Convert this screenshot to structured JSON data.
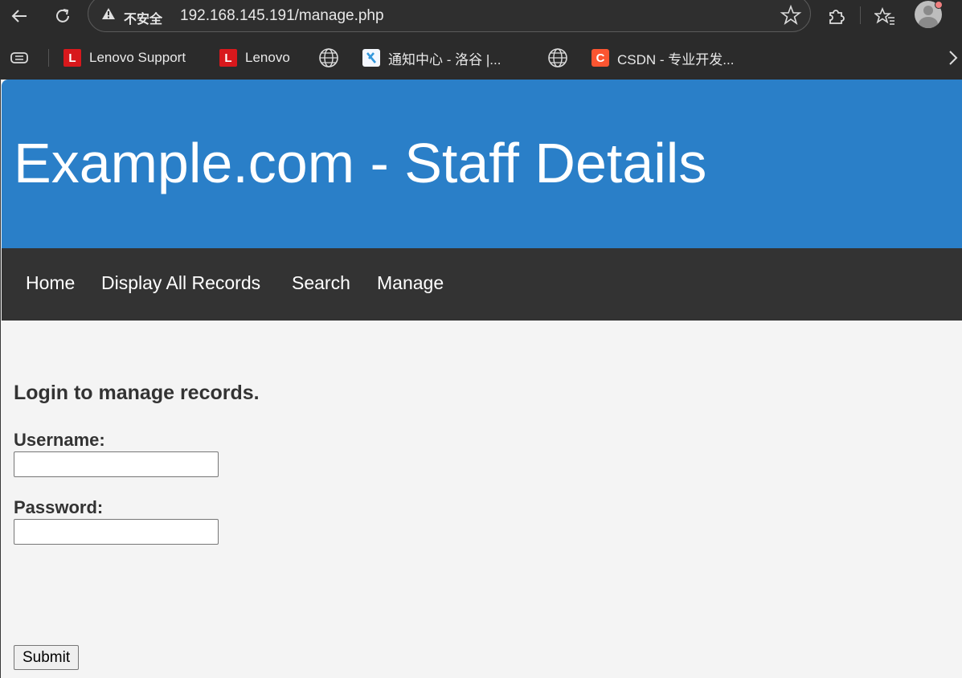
{
  "browser": {
    "url_warning": "不安全",
    "url": "192.168.145.191/manage.php",
    "bookmarks": [
      {
        "label": "Lenovo Support",
        "icon": "lenovo-icon"
      },
      {
        "label": "Lenovo",
        "icon": "lenovo-icon"
      },
      {
        "label": "",
        "icon": "globe-icon"
      },
      {
        "label": "通知中心 - 洛谷 |...",
        "icon": "luogu-icon"
      },
      {
        "label": "",
        "icon": "globe-icon"
      },
      {
        "label": "CSDN - 专业开发...",
        "icon": "csdn-icon"
      }
    ]
  },
  "header": {
    "title": "Example.com - Staff Details"
  },
  "nav": {
    "items": [
      "Home",
      "Display All Records",
      "Search",
      "Manage"
    ]
  },
  "login": {
    "heading": "Login to manage records.",
    "username_label": "Username:",
    "username_value": "",
    "password_label": "Password:",
    "password_value": "",
    "submit_label": "Submit"
  },
  "colors": {
    "header_bg": "#2a7fc8",
    "nav_bg": "#333333",
    "page_bg": "#f4f4f4",
    "chrome_bg": "#2b2b2b"
  }
}
